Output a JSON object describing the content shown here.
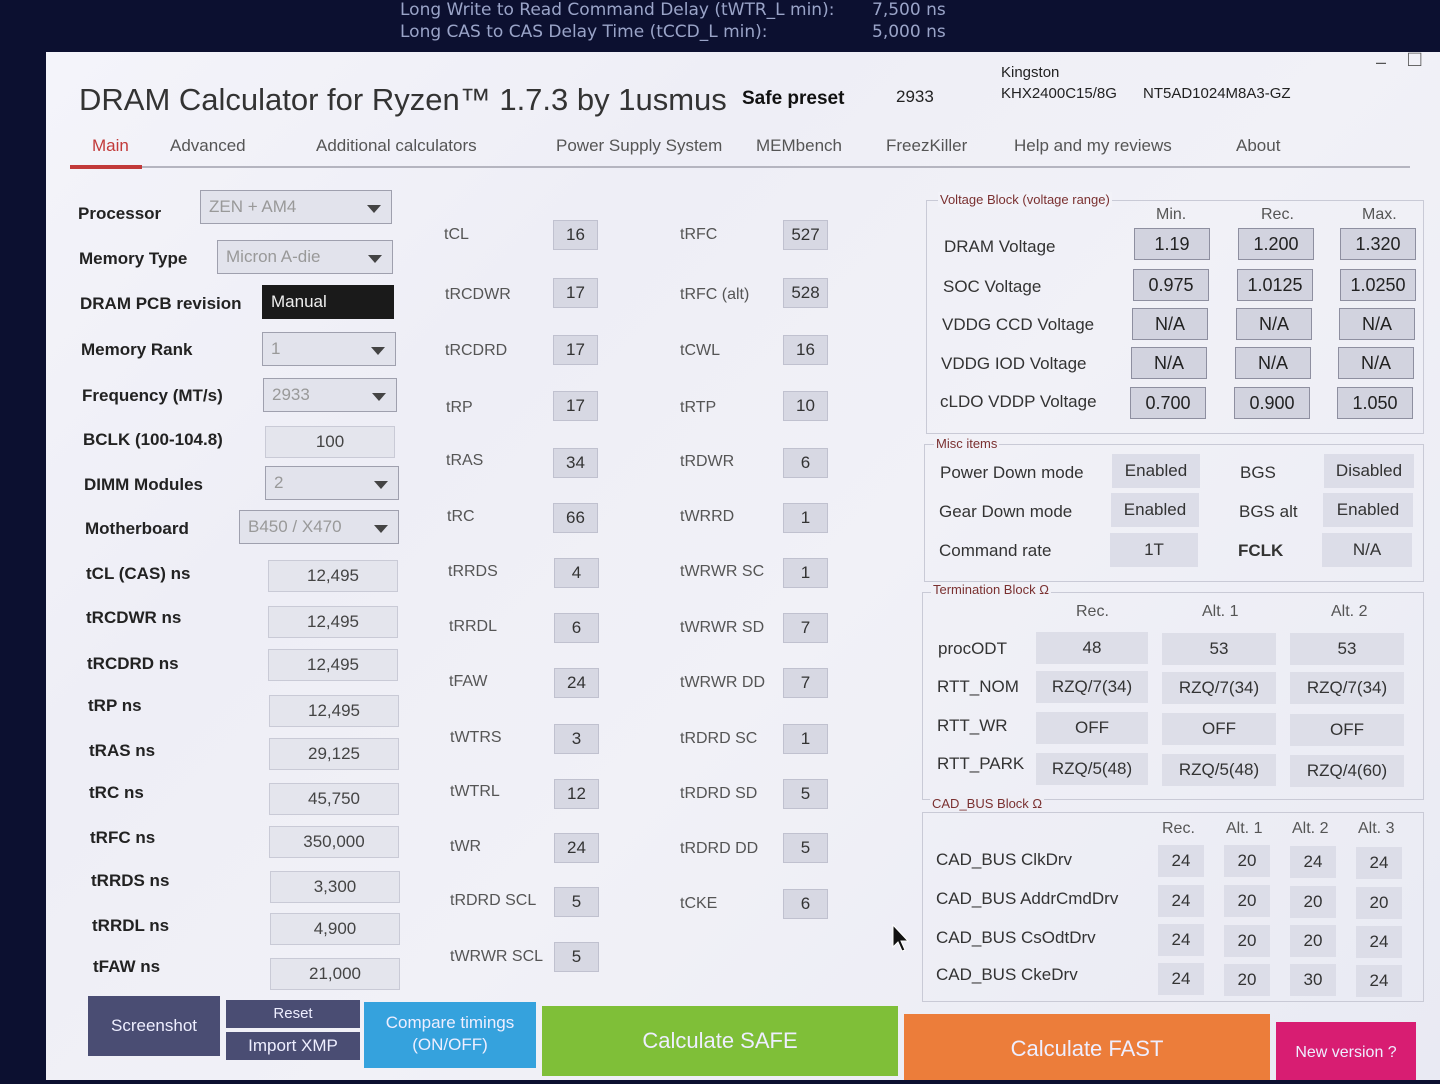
{
  "background_text": [
    {
      "label": "Long Write to Read Command Delay (tWTR_L min):",
      "value": "7,500 ns"
    },
    {
      "label": "Long CAS to CAS Delay Time (tCCD_L min):",
      "value": "5,000 ns"
    }
  ],
  "window": {
    "title": "DRAM Calculator for Ryzen™ 1.7.3 by 1usmus",
    "minimize": "–",
    "maximize": "□"
  },
  "header": {
    "preset_label": "Safe preset",
    "preset_value": "2933",
    "manufacturer": "Kingston",
    "part_number": "KHX2400C15/8G",
    "chip": "NT5AD1024M8A3-GZ"
  },
  "tabs": [
    "Main",
    "Advanced",
    "Additional calculators",
    "Power Supply System",
    "MEMbench",
    "FreezKiller",
    "Help and my reviews",
    "About"
  ],
  "active_tab": "Main",
  "settings": [
    {
      "label": "Processor",
      "value": "ZEN + AM4",
      "type": "combo"
    },
    {
      "label": "Memory Type",
      "value": "Micron A-die",
      "type": "combo"
    },
    {
      "label": "DRAM PCB revision",
      "value": "Manual",
      "type": "dark"
    },
    {
      "label": "Memory Rank",
      "value": "1",
      "type": "combo"
    },
    {
      "label": "Frequency (MT/s)",
      "value": "2933",
      "type": "combo"
    },
    {
      "label": "BCLK (100-104.8)",
      "value": "100",
      "type": "box"
    },
    {
      "label": "DIMM Modules",
      "value": "2",
      "type": "combo"
    },
    {
      "label": "Motherboard",
      "value": "B450 / X470",
      "type": "combo"
    },
    {
      "label": "tCL (CAS) ns",
      "value": "12,495",
      "type": "box"
    },
    {
      "label": "tRCDWR ns",
      "value": "12,495",
      "type": "box"
    },
    {
      "label": "tRCDRD ns",
      "value": "12,495",
      "type": "box"
    },
    {
      "label": "tRP ns",
      "value": "12,495",
      "type": "box"
    },
    {
      "label": "tRAS ns",
      "value": "29,125",
      "type": "box"
    },
    {
      "label": "tRC ns",
      "value": "45,750",
      "type": "box"
    },
    {
      "label": "tRFC ns",
      "value": "350,000",
      "type": "box"
    },
    {
      "label": "tRRDS ns",
      "value": "3,300",
      "type": "box"
    },
    {
      "label": "tRRDL ns",
      "value": "4,900",
      "type": "box"
    },
    {
      "label": "tFAW ns",
      "value": "21,000",
      "type": "box"
    }
  ],
  "timings_left": [
    {
      "label": "tCL",
      "value": "16"
    },
    {
      "label": "tRCDWR",
      "value": "17"
    },
    {
      "label": "tRCDRD",
      "value": "17"
    },
    {
      "label": "tRP",
      "value": "17"
    },
    {
      "label": "tRAS",
      "value": "34"
    },
    {
      "label": "tRC",
      "value": "66"
    },
    {
      "label": "tRRDS",
      "value": "4"
    },
    {
      "label": "tRRDL",
      "value": "6"
    },
    {
      "label": "tFAW",
      "value": "24"
    },
    {
      "label": "tWTRS",
      "value": "3"
    },
    {
      "label": "tWTRL",
      "value": "12"
    },
    {
      "label": "tWR",
      "value": "24"
    },
    {
      "label": "tRDRD SCL",
      "value": "5"
    },
    {
      "label": "tWRWR SCL",
      "value": "5"
    }
  ],
  "timings_right": [
    {
      "label": "tRFC",
      "value": "527"
    },
    {
      "label": "tRFC (alt)",
      "value": "528"
    },
    {
      "label": "tCWL",
      "value": "16"
    },
    {
      "label": "tRTP",
      "value": "10"
    },
    {
      "label": "tRDWR",
      "value": "6"
    },
    {
      "label": "tWRRD",
      "value": "1"
    },
    {
      "label": "tWRWR SC",
      "value": "1"
    },
    {
      "label": "tWRWR SD",
      "value": "7"
    },
    {
      "label": "tWRWR DD",
      "value": "7"
    },
    {
      "label": "tRDRD SC",
      "value": "1"
    },
    {
      "label": "tRDRD SD",
      "value": "5"
    },
    {
      "label": "tRDRD DD",
      "value": "5"
    },
    {
      "label": "tCKE",
      "value": "6"
    }
  ],
  "voltage_block": {
    "title": "Voltage Block (voltage range)",
    "columns": [
      "Min.",
      "Rec.",
      "Max."
    ],
    "rows": [
      {
        "label": "DRAM Voltage",
        "values": [
          "1.19",
          "1.200",
          "1.320"
        ]
      },
      {
        "label": "SOC Voltage",
        "values": [
          "0.975",
          "1.0125",
          "1.0250"
        ]
      },
      {
        "label": "VDDG  CCD Voltage",
        "values": [
          "N/A",
          "N/A",
          "N/A"
        ]
      },
      {
        "label": "VDDG  IOD Voltage",
        "values": [
          "N/A",
          "N/A",
          "N/A"
        ]
      },
      {
        "label": "cLDO VDDP Voltage",
        "values": [
          "0.700",
          "0.900",
          "1.050"
        ]
      }
    ]
  },
  "misc": {
    "title": "Misc items",
    "rows": [
      {
        "label": "Power Down mode",
        "value": "Enabled",
        "label2": "BGS",
        "value2": "Disabled"
      },
      {
        "label": "Gear Down mode",
        "value": "Enabled",
        "label2": "BGS alt",
        "value2": "Enabled"
      },
      {
        "label": "Command rate",
        "value": "1T",
        "label2": "FCLK",
        "value2": "N/A"
      }
    ]
  },
  "termination": {
    "title": "Termination Block Ω",
    "columns": [
      "Rec.",
      "Alt. 1",
      "Alt. 2"
    ],
    "rows": [
      {
        "label": "procODT",
        "values": [
          "48",
          "53",
          "53"
        ]
      },
      {
        "label": "RTT_NOM",
        "values": [
          "RZQ/7(34)",
          "RZQ/7(34)",
          "RZQ/7(34)"
        ]
      },
      {
        "label": "RTT_WR",
        "values": [
          "OFF",
          "OFF",
          "OFF"
        ]
      },
      {
        "label": "RTT_PARK",
        "values": [
          "RZQ/5(48)",
          "RZQ/5(48)",
          "RZQ/4(60)"
        ]
      }
    ]
  },
  "cad_bus": {
    "title": "CAD_BUS Block Ω",
    "columns": [
      "Rec.",
      "Alt. 1",
      "Alt. 2",
      "Alt. 3"
    ],
    "rows": [
      {
        "label": "CAD_BUS ClkDrv",
        "values": [
          "24",
          "20",
          "24",
          "24"
        ]
      },
      {
        "label": "CAD_BUS AddrCmdDrv",
        "values": [
          "24",
          "20",
          "20",
          "20"
        ]
      },
      {
        "label": "CAD_BUS CsOdtDrv",
        "values": [
          "24",
          "20",
          "20",
          "24"
        ]
      },
      {
        "label": "CAD_BUS CkeDrv",
        "values": [
          "24",
          "20",
          "30",
          "24"
        ]
      }
    ]
  },
  "footer": {
    "screenshot": "Screenshot",
    "reset": "Reset",
    "import_xmp": "Import XMP",
    "compare_line1": "Compare timings",
    "compare_line2": "(ON/OFF)",
    "calc_safe": "Calculate SAFE",
    "calc_fast": "Calculate FAST",
    "new_version": "New version ?",
    "colors": {
      "dark": "#4a4d73",
      "blue": "#35a2dd",
      "green": "#7fbf38",
      "orange": "#ec7d3a",
      "pink": "#d81d72"
    }
  }
}
